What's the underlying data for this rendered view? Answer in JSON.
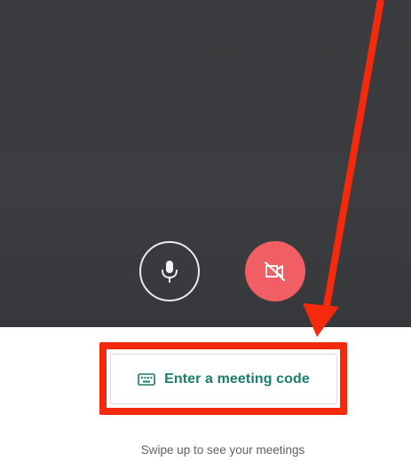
{
  "controls": {
    "microphone": {
      "icon": "microphone-icon",
      "state": "on",
      "color": "#e8eaed"
    },
    "camera": {
      "icon": "camera-off-icon",
      "state": "off",
      "color": "#f15e63"
    }
  },
  "meeting_code_button": {
    "label": "Enter a meeting code",
    "icon": "keyboard-icon",
    "label_color": "#1a7d6e"
  },
  "swipe_hint": "Swipe up to see your meetings",
  "annotation": {
    "type": "arrow-and-box",
    "color": "#f5290b"
  }
}
